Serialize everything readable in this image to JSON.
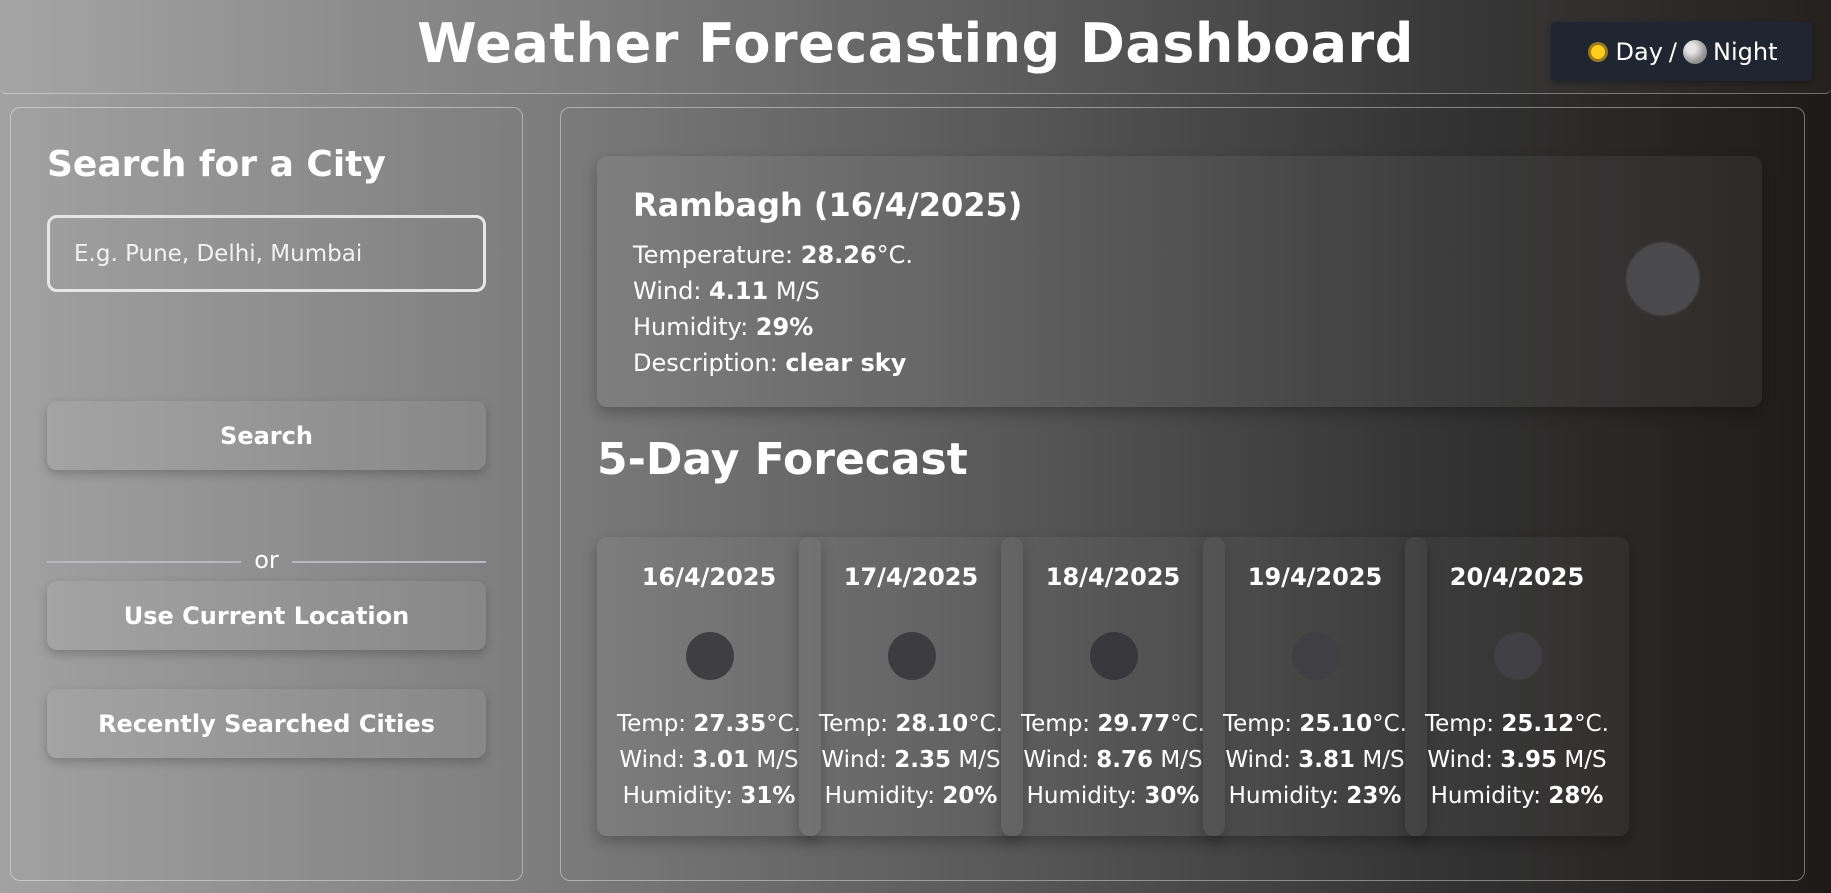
{
  "header": {
    "title": "Weather Forecasting Dashboard",
    "mode_toggle": {
      "day_label": "Day",
      "separator": "/",
      "night_label": "Night",
      "day_icon": "sun-icon",
      "night_icon": "moon-icon"
    }
  },
  "sidebar": {
    "heading": "Search for a City",
    "search_placeholder": "E.g. Pune, Delhi, Mumbai",
    "search_value": "",
    "search_button": "Search",
    "divider_text": "or",
    "location_button": "Use Current Location",
    "recent_button": "Recently Searched Cities"
  },
  "current": {
    "city_line": "Rambagh (16/4/2025)",
    "temperature_label": "Temperature: ",
    "temperature_value": "28.26",
    "temperature_unit": "°C.",
    "wind_label": "Wind: ",
    "wind_value": "4.11",
    "wind_unit": " M/S",
    "humidity_label": "Humidity: ",
    "humidity_value": "29%",
    "description_label": "Description: ",
    "description_value": "clear sky",
    "icon": "weather-icon",
    "icon_color": "#4a4a4c"
  },
  "forecast": {
    "title": "5-Day Forecast",
    "temp_label": "Temp: ",
    "temp_unit": "°C.",
    "wind_label": "Wind: ",
    "wind_unit": " M/S",
    "humidity_label": "Humidity: ",
    "days": [
      {
        "date": "16/4/2025",
        "temp": "27.35",
        "wind": "3.01",
        "humidity": "31%",
        "icon_color": "#3f3f42"
      },
      {
        "date": "17/4/2025",
        "temp": "28.10",
        "wind": "2.35",
        "humidity": "20%",
        "icon_color": "#3d3d40"
      },
      {
        "date": "18/4/2025",
        "temp": "29.77",
        "wind": "8.76",
        "humidity": "30%",
        "icon_color": "#38383c"
      },
      {
        "date": "19/4/2025",
        "temp": "25.10",
        "wind": "3.81",
        "humidity": "23%",
        "icon_color": "#404044"
      },
      {
        "date": "20/4/2025",
        "temp": "25.12",
        "wind": "3.95",
        "humidity": "28%",
        "icon_color": "#404044"
      }
    ]
  }
}
